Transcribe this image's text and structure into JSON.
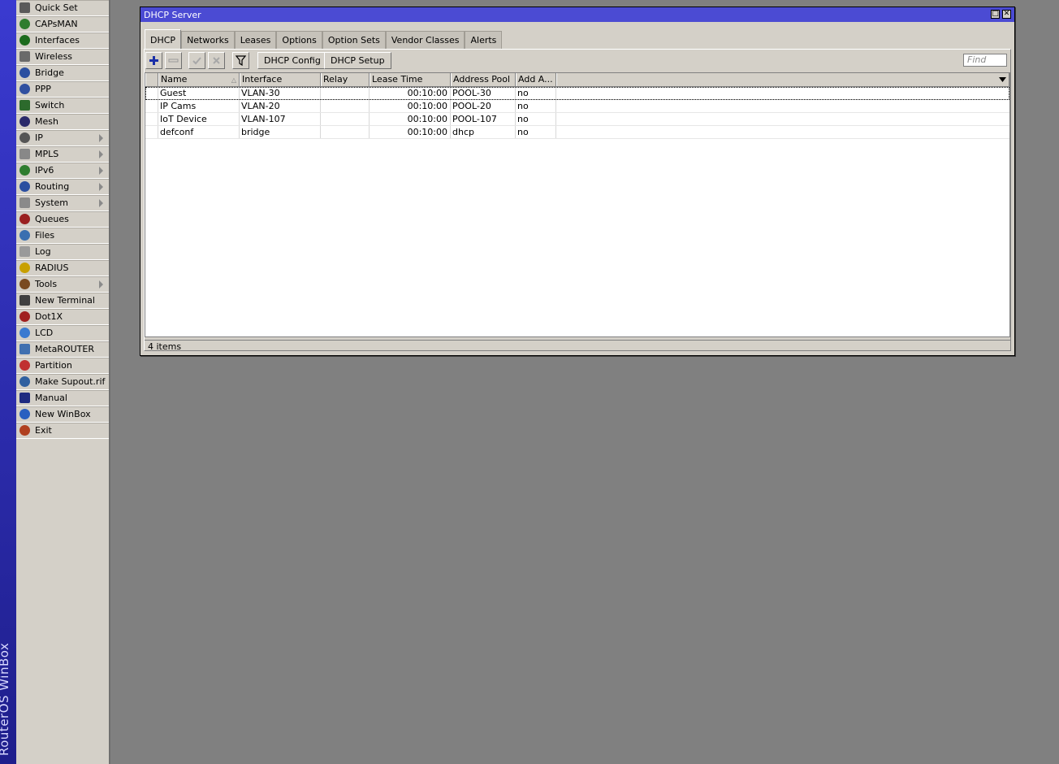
{
  "app": {
    "brand": "RouterOS WinBox"
  },
  "menu": {
    "items": [
      {
        "label": "Quick Set",
        "icon": "quick-set-icon",
        "submenu": false
      },
      {
        "label": "CAPsMAN",
        "icon": "capsman-icon",
        "submenu": false
      },
      {
        "label": "Interfaces",
        "icon": "interfaces-icon",
        "submenu": false
      },
      {
        "label": "Wireless",
        "icon": "wireless-icon",
        "submenu": false
      },
      {
        "label": "Bridge",
        "icon": "bridge-icon",
        "submenu": false
      },
      {
        "label": "PPP",
        "icon": "ppp-icon",
        "submenu": false
      },
      {
        "label": "Switch",
        "icon": "switch-icon",
        "submenu": false
      },
      {
        "label": "Mesh",
        "icon": "mesh-icon",
        "submenu": false
      },
      {
        "label": "IP",
        "icon": "ip-icon",
        "submenu": true
      },
      {
        "label": "MPLS",
        "icon": "mpls-icon",
        "submenu": true
      },
      {
        "label": "IPv6",
        "icon": "ipv6-icon",
        "submenu": true
      },
      {
        "label": "Routing",
        "icon": "routing-icon",
        "submenu": true
      },
      {
        "label": "System",
        "icon": "system-icon",
        "submenu": true
      },
      {
        "label": "Queues",
        "icon": "queues-icon",
        "submenu": false
      },
      {
        "label": "Files",
        "icon": "files-icon",
        "submenu": false
      },
      {
        "label": "Log",
        "icon": "log-icon",
        "submenu": false
      },
      {
        "label": "RADIUS",
        "icon": "radius-icon",
        "submenu": false
      },
      {
        "label": "Tools",
        "icon": "tools-icon",
        "submenu": true
      },
      {
        "label": "New Terminal",
        "icon": "terminal-icon",
        "submenu": false
      },
      {
        "label": "Dot1X",
        "icon": "dot1x-icon",
        "submenu": false
      },
      {
        "label": "LCD",
        "icon": "lcd-icon",
        "submenu": false
      },
      {
        "label": "MetaROUTER",
        "icon": "metarouter-icon",
        "submenu": false
      },
      {
        "label": "Partition",
        "icon": "partition-icon",
        "submenu": false
      },
      {
        "label": "Make Supout.rif",
        "icon": "supout-icon",
        "submenu": false
      },
      {
        "label": "Manual",
        "icon": "manual-icon",
        "submenu": false
      },
      {
        "label": "New WinBox",
        "icon": "winbox-icon",
        "submenu": false
      },
      {
        "label": "Exit",
        "icon": "exit-icon",
        "submenu": false
      }
    ]
  },
  "window": {
    "title": "DHCP Server",
    "tabs": [
      "DHCP",
      "Networks",
      "Leases",
      "Options",
      "Option Sets",
      "Vendor Classes",
      "Alerts"
    ],
    "active_tab": "DHCP",
    "toolbar": {
      "config_label": "DHCP Config",
      "setup_label": "DHCP Setup",
      "find_placeholder": "Find"
    },
    "table": {
      "columns": [
        "Name",
        "Interface",
        "Relay",
        "Lease Time",
        "Address Pool",
        "Add A..."
      ],
      "rows": [
        {
          "name": "Guest",
          "interface": "VLAN-30",
          "relay": "",
          "lease_time": "00:10:00",
          "address_pool": "POOL-30",
          "add_arp": "no"
        },
        {
          "name": "IP Cams",
          "interface": "VLAN-20",
          "relay": "",
          "lease_time": "00:10:00",
          "address_pool": "POOL-20",
          "add_arp": "no"
        },
        {
          "name": "IoT Device",
          "interface": "VLAN-107",
          "relay": "",
          "lease_time": "00:10:00",
          "address_pool": "POOL-107",
          "add_arp": "no"
        },
        {
          "name": "defconf",
          "interface": "bridge",
          "relay": "",
          "lease_time": "00:10:00",
          "address_pool": "dhcp",
          "add_arp": "no"
        }
      ]
    },
    "status": "4 items"
  },
  "colors": {
    "titlebar": "#4b4bd3",
    "brandbar": "#2a2aa8",
    "desktop": "#808080",
    "panel": "#d4d0c8"
  }
}
